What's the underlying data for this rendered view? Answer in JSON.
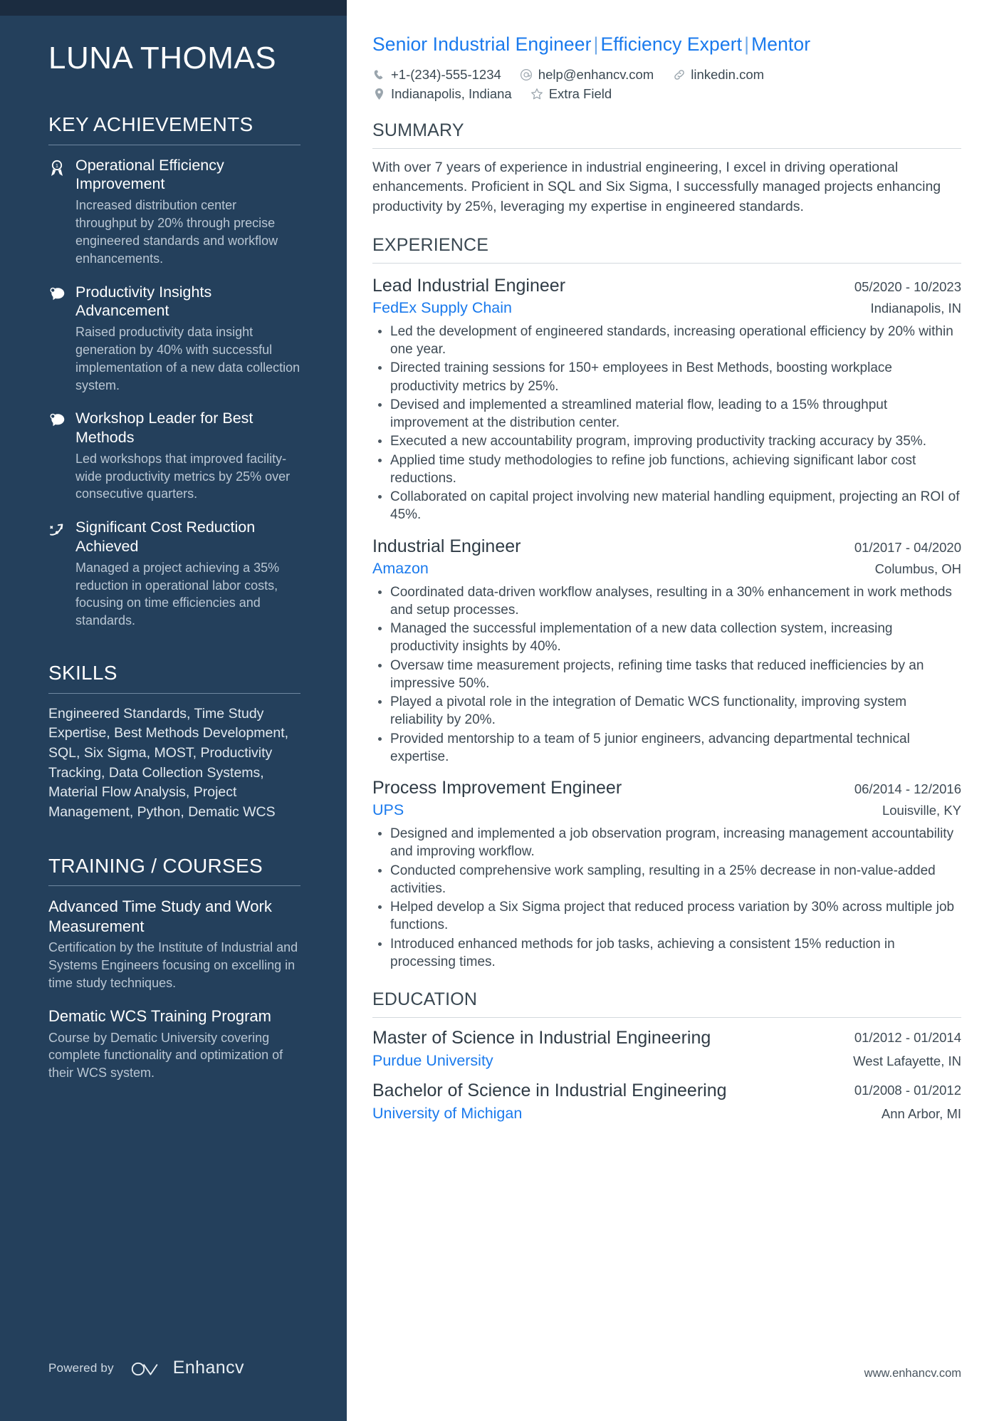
{
  "sidebar": {
    "name": "LUNA THOMAS",
    "key_achievements": {
      "heading": "KEY ACHIEVEMENTS",
      "items": [
        {
          "icon": "award-medal-icon",
          "title": "Operational Efficiency Improvement",
          "description": "Increased distribution center throughput by 20% through precise engineered standards and workflow enhancements."
        },
        {
          "icon": "head-idea-icon",
          "title": "Productivity Insights Advancement",
          "description": "Raised productivity data insight generation by 40% with successful implementation of a new data collection system."
        },
        {
          "icon": "head-idea-icon",
          "title": "Workshop Leader for Best Methods",
          "description": "Led workshops that improved facility-wide productivity metrics by 25% over consecutive quarters."
        },
        {
          "icon": "growth-arrow-icon",
          "title": "Significant Cost Reduction Achieved",
          "description": "Managed a project achieving a 35% reduction in operational labor costs, focusing on time efficiencies and standards."
        }
      ]
    },
    "skills": {
      "heading": "SKILLS",
      "text": "Engineered Standards, Time Study Expertise, Best Methods Development, SQL, Six Sigma, MOST, Productivity Tracking, Data Collection Systems, Material Flow Analysis, Project Management, Python, Dematic WCS"
    },
    "training": {
      "heading": "TRAINING / COURSES",
      "items": [
        {
          "title": "Advanced Time Study and Work Measurement",
          "description": "Certification by the Institute of Industrial and Systems Engineers focusing on excelling in time study techniques."
        },
        {
          "title": "Dematic WCS Training Program",
          "description": "Course by Dematic University covering complete functionality and optimization of their WCS system."
        }
      ]
    },
    "footer": {
      "powered_by": "Powered by",
      "brand": "Enhancv"
    }
  },
  "main": {
    "headline_parts": [
      "Senior Industrial Engineer",
      "Efficiency Expert",
      "Mentor"
    ],
    "headline_separator": "|",
    "contacts": {
      "row1": [
        {
          "icon": "phone-icon",
          "value": "+1-(234)-555-1234"
        },
        {
          "icon": "email-at-icon",
          "value": "help@enhancv.com"
        },
        {
          "icon": "link-icon",
          "value": "linkedin.com"
        }
      ],
      "row2": [
        {
          "icon": "location-pin-icon",
          "value": "Indianapolis, Indiana"
        },
        {
          "icon": "star-icon",
          "value": "Extra Field"
        }
      ]
    },
    "summary": {
      "heading": "SUMMARY",
      "text": "With over 7 years of experience in industrial engineering, I excel in driving operational enhancements. Proficient in SQL and Six Sigma, I successfully managed projects enhancing productivity by 25%, leveraging my expertise in engineered standards."
    },
    "experience": {
      "heading": "EXPERIENCE",
      "jobs": [
        {
          "title": "Lead Industrial Engineer",
          "date": "05/2020 - 10/2023",
          "company": "FedEx Supply Chain",
          "location": "Indianapolis, IN",
          "bullets": [
            "Led the development of engineered standards, increasing operational efficiency by 20% within one year.",
            "Directed training sessions for 150+ employees in Best Methods, boosting workplace productivity metrics by 25%.",
            "Devised and implemented a streamlined material flow, leading to a 15% throughput improvement at the distribution center.",
            "Executed a new accountability program, improving productivity tracking accuracy by 35%.",
            "Applied time study methodologies to refine job functions, achieving significant labor cost reductions.",
            "Collaborated on capital project involving new material handling equipment, projecting an ROI of 45%."
          ]
        },
        {
          "title": "Industrial Engineer",
          "date": "01/2017 - 04/2020",
          "company": "Amazon",
          "location": "Columbus, OH",
          "bullets": [
            "Coordinated data-driven workflow analyses, resulting in a 30% enhancement in work methods and setup processes.",
            "Managed the successful implementation of a new data collection system, increasing productivity insights by 40%.",
            "Oversaw time measurement projects, refining time tasks that reduced inefficiencies by an impressive 50%.",
            "Played a pivotal role in the integration of Dematic WCS functionality, improving system reliability by 20%.",
            "Provided mentorship to a team of 5 junior engineers, advancing departmental technical expertise."
          ]
        },
        {
          "title": "Process Improvement Engineer",
          "date": "06/2014 - 12/2016",
          "company": "UPS",
          "location": "Louisville, KY",
          "bullets": [
            "Designed and implemented a job observation program, increasing management accountability and improving workflow.",
            "Conducted comprehensive work sampling, resulting in a 25% decrease in non-value-added activities.",
            "Helped develop a Six Sigma project that reduced process variation by 30% across multiple job functions.",
            "Introduced enhanced methods for job tasks, achieving a consistent 15% reduction in processing times."
          ]
        }
      ]
    },
    "education": {
      "heading": "EDUCATION",
      "entries": [
        {
          "degree": "Master of Science in Industrial Engineering",
          "date": "01/2012 - 01/2014",
          "school": "Purdue University",
          "location": "West Lafayette, IN"
        },
        {
          "degree": "Bachelor of Science in Industrial Engineering",
          "date": "01/2008 - 01/2012",
          "school": "University of Michigan",
          "location": "Ann Arbor, MI"
        }
      ]
    },
    "footer_site": "www.enhancv.com"
  },
  "colors": {
    "sidebar_bg": "#24405c",
    "sidebar_top_strip": "#1b2c40",
    "accent_blue": "#1a7aed",
    "body_text": "#3e4a54"
  }
}
